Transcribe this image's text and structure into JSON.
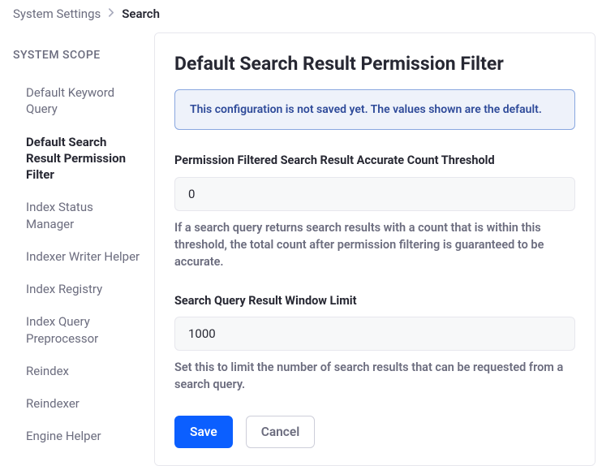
{
  "breadcrumb": {
    "parent": "System Settings",
    "current": "Search"
  },
  "sidebar": {
    "heading": "SYSTEM SCOPE",
    "items": [
      {
        "label": "Default Keyword Query",
        "active": false
      },
      {
        "label": "Default Search Result Permission Filter",
        "active": true
      },
      {
        "label": "Index Status Manager",
        "active": false
      },
      {
        "label": "Indexer Writer Helper",
        "active": false
      },
      {
        "label": "Index Registry",
        "active": false
      },
      {
        "label": "Index Query Preprocessor",
        "active": false
      },
      {
        "label": "Reindex",
        "active": false
      },
      {
        "label": "Reindexer",
        "active": false
      },
      {
        "label": "Engine Helper",
        "active": false
      }
    ]
  },
  "page": {
    "title": "Default Search Result Permission Filter",
    "alert": "This configuration is not saved yet. The values shown are the default."
  },
  "fields": {
    "threshold": {
      "label": "Permission Filtered Search Result Accurate Count Threshold",
      "value": "0",
      "help": "If a search query returns search results with a count that is within this threshold, the total count after permission filtering is guaranteed to be accurate."
    },
    "windowLimit": {
      "label": "Search Query Result Window Limit",
      "value": "1000",
      "help": "Set this to limit the number of search results that can be requested from a search query."
    }
  },
  "buttons": {
    "save": "Save",
    "cancel": "Cancel"
  }
}
